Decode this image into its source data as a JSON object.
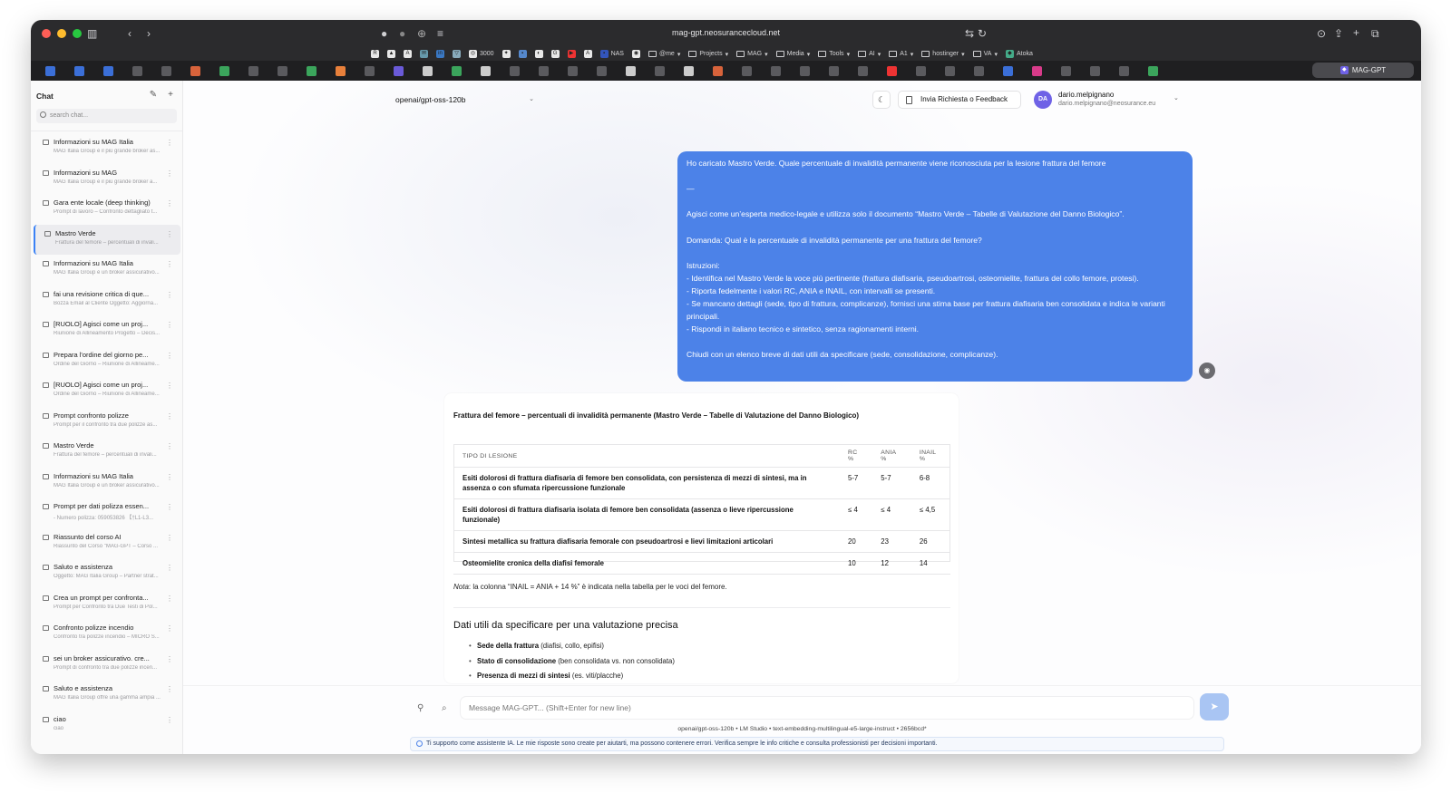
{
  "browser": {
    "url": "mag-gpt.neosurancecloud.net",
    "bookmarks": [
      "3000",
      "NAS",
      "@me",
      "Projects",
      "MAG",
      "Media",
      "Tools",
      "AI",
      "A1",
      "hostinger",
      "VA",
      "Atoka"
    ],
    "active_tab": "MAG-GPT"
  },
  "sidebar": {
    "title": "Chat",
    "search_placeholder": "search chat...",
    "items": [
      {
        "title": "Informazioni su MAG Italia",
        "subtitle": "MAG Italia Group è il più grande broker as..."
      },
      {
        "title": "Informazioni su MAG",
        "subtitle": "MAG Italia Group è il più grande broker a..."
      },
      {
        "title": "Gara ente locale (deep thinking)",
        "subtitle": "Prompt di lavoro – Confronto dettagliato t..."
      },
      {
        "title": "Mastro Verde",
        "subtitle": "Frattura del femore – percentuali di invali..."
      },
      {
        "title": "Informazioni su MAG Italia",
        "subtitle": "MAG Italia Group è un broker assicurativo..."
      },
      {
        "title": "fai una revisione critica di que...",
        "subtitle": "Bozza Email al Cliente Oggetto: Aggiorna..."
      },
      {
        "title": "[RUOLO] Agisci come un proj...",
        "subtitle": "Riunione di Allineamento Progetto – Decis..."
      },
      {
        "title": "Prepara l'ordine del giorno pe...",
        "subtitle": "Ordine del Giorno – Riunione di Allineame..."
      },
      {
        "title": "[RUOLO] Agisci come un proj...",
        "subtitle": "Ordine del Giorno – Riunione di Allineame..."
      },
      {
        "title": "Prompt confronto polizze",
        "subtitle": "Prompt per il confronto tra due polizze as..."
      },
      {
        "title": "Mastro Verde",
        "subtitle": "Frattura del femore – percentuali di invali..."
      },
      {
        "title": "Informazioni su MAG Italia",
        "subtitle": "MAG Italia Group è un broker assicurativo..."
      },
      {
        "title": "Prompt per dati polizza essen...",
        "subtitle": "- Numero polizza: 059053826 【†L1-L3..."
      },
      {
        "title": "Riassunto del corso AI",
        "subtitle": "Riassunto del Corso \"MAG-GPT – Corso ..."
      },
      {
        "title": "Saluto e assistenza",
        "subtitle": "Oggetto: MAG Italia Group – Partner strat..."
      },
      {
        "title": "Crea un prompt per confronta...",
        "subtitle": "Prompt per Confronto tra Due Testi di Pol..."
      },
      {
        "title": "Confronto polizze incendio",
        "subtitle": "Confronto tra polizze incendio – MICRO S..."
      },
      {
        "title": "sei un broker assicurativo. cre...",
        "subtitle": "Prompt di confronto tra due polizze incen..."
      },
      {
        "title": "Saluto e assistenza",
        "subtitle": "MAG Italia Group offre una gamma ampia ..."
      },
      {
        "title": "ciao",
        "subtitle": "ciao"
      }
    ]
  },
  "header": {
    "model": "openai/gpt-oss-120b",
    "feedback_label": "Invia Richiesta o Feedback",
    "user_initials": "DA",
    "user_name": "dario.melpignano",
    "user_email": "dario.melpignano@neosurance.eu"
  },
  "user_message": {
    "text": "Ho caricato Mastro Verde. Quale percentuale di invalidità permanente viene riconosciuta per la lesione frattura del femore\n\n—\n\nAgisci come un’esperta medico-legale e utilizza solo il documento “Mastro Verde – Tabelle di Valutazione del Danno Biologico”.\n\nDomanda: Qual è la percentuale di invalidità permanente per una frattura del femore?\n\nIstruzioni:\n- Identifica nel Mastro Verde la voce più pertinente (frattura diafisaria, pseudoartrosi, osteomielite, frattura del collo femore, protesi).\n- Riporta fedelmente i valori RC, ANIA e INAIL, con intervalli se presenti.\n- Se mancano dettagli (sede, tipo di frattura, complicanze), fornisci una stima base per frattura diafisaria ben consolidata e indica le varianti principali.\n- Rispondi in italiano tecnico e sintetico, senza ragionamenti interni.\n\nChiudi con un elenco breve di dati utili da specificare (sede, consolidazione, complicanze)."
  },
  "assistant": {
    "title": "Frattura del femore – percentuali di invalidità permanente (Mastro Verde – Tabelle di Valutazione del Danno Biologico)",
    "table": {
      "headers": [
        "TIPO DI LESIONE",
        "RC %",
        "ANIA %",
        "INAIL %"
      ],
      "rows": [
        [
          "Esiti dolorosi di frattura diafisaria di femore ben consolidata, con persistenza di mezzi di sintesi, ma in assenza o con sfumata ripercussione funzionale",
          "5-7",
          "5-7",
          "6-8"
        ],
        [
          "Esiti dolorosi di frattura diafisaria isolata di femore ben consolidata (assenza o lieve ripercussione funzionale)",
          "≤ 4",
          "≤ 4",
          "≤ 4,5"
        ],
        [
          "Sintesi metallica su frattura diafisaria femorale con pseudoartrosi e lievi limitazioni articolari",
          "20",
          "23",
          "26"
        ],
        [
          "Osteomielite cronica della diafisi femorale",
          "10",
          "12",
          "14"
        ]
      ]
    },
    "note_label": "Nota",
    "note_text": ": la colonna “INAIL = ANIA + 14 %” è indicata nella tabella per le voci del femore.",
    "section_title": "Dati utili da specificare per una valutazione precisa",
    "bullets": [
      {
        "bold": "Sede della frattura",
        "rest": " (diafisi, collo, epifisi)"
      },
      {
        "bold": "Stato di consolidazione",
        "rest": " (ben consolidata vs. non consolidata)"
      },
      {
        "bold": "Presenza di mezzi di sintesi",
        "rest": " (es. viti/placche)"
      }
    ]
  },
  "composer": {
    "placeholder": "Message MAG-GPT... (Shift+Enter for new line)",
    "meta": "openai/gpt-oss-120b • LM Studio • text-embedding-multilingual-e5-large-instruct • 2656bcd*",
    "disclaimer": "Ti supporto come assistente IA. Le mie risposte sono create per aiutarti, ma possono contenere errori. Verifica sempre le info critiche e consulta professionisti per decisioni importanti."
  },
  "colors": {
    "accent": "#4c82e8",
    "send_button": "#a9c5f3",
    "avatar": "#6f62e6"
  }
}
